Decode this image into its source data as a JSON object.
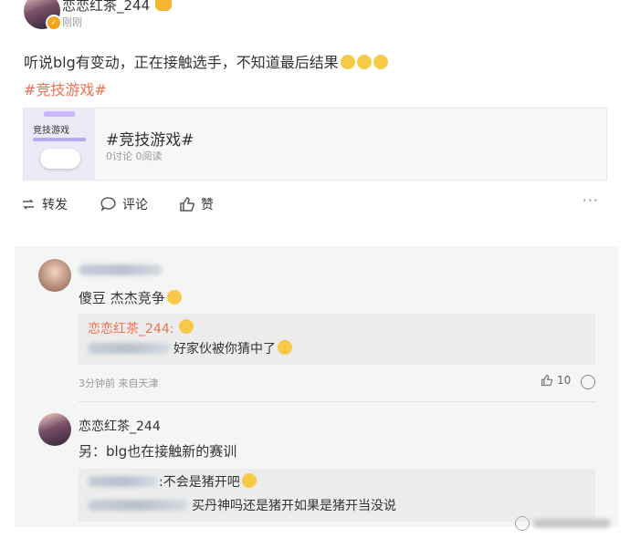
{
  "post": {
    "username": "恋恋红茶_244",
    "time": "刚刚",
    "text": "听说blg有变动，正在接触选手，不知道最后结果",
    "hashtag": "#竞技游戏#",
    "card": {
      "thumb_label": "竞技游戏",
      "title": "#竞技游戏#",
      "meta": "0讨论 0阅读"
    },
    "actions": {
      "repost": "转发",
      "comment": "评论",
      "like": "赞",
      "more": "···"
    }
  },
  "comments": [
    {
      "text": "傻豆 杰杰竞争",
      "quote_name": "恋恋红茶_244:",
      "quote_text": "好家伙被你猜中了",
      "meta": "3分钟前 来自天津",
      "likes": "10"
    },
    {
      "username": "恋恋红茶_244",
      "text": "另：blg也在接触新的赛训",
      "quote_lines": [
        ":不会是猪开吧",
        "买丹神吗还是猪开如果是猪开当没说"
      ]
    }
  ]
}
